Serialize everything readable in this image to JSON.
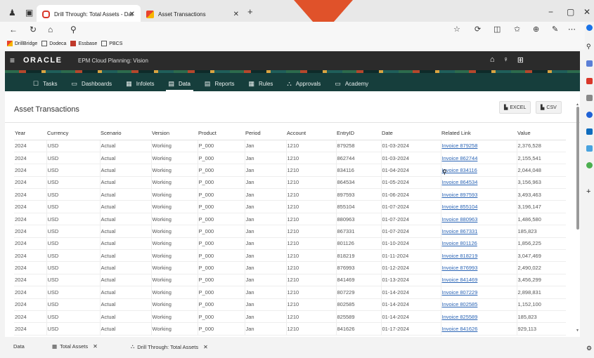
{
  "browser": {
    "tabs": [
      {
        "label": "Drill Through: Total Assets - Dat",
        "active": true
      },
      {
        "label": "Asset Transactions",
        "active": false
      }
    ],
    "new_tab": "+",
    "window": {
      "minimize": "−",
      "restore": "▢",
      "close": "✕"
    },
    "bookmarks": [
      "DrillBridge",
      "Dodeca",
      "Essbase",
      "PBCS"
    ]
  },
  "header": {
    "brand": "ORACLE",
    "app_title": "EPM Cloud Planning: Vision"
  },
  "nav": {
    "items": [
      {
        "label": "Tasks",
        "icon": "☐"
      },
      {
        "label": "Dashboards",
        "icon": "▭"
      },
      {
        "label": "Infolets",
        "icon": "▦"
      },
      {
        "label": "Data",
        "icon": "▤",
        "active": true
      },
      {
        "label": "Reports",
        "icon": "▤"
      },
      {
        "label": "Rules",
        "icon": "▦"
      },
      {
        "label": "Approvals",
        "icon": "⛬"
      },
      {
        "label": "Academy",
        "icon": "▭"
      }
    ]
  },
  "page": {
    "title": "Asset Transactions",
    "excel_label": "EXCEL",
    "csv_label": "CSV"
  },
  "table": {
    "columns": [
      "Year",
      "Currency",
      "Scenario",
      "Version",
      "Product",
      "Period",
      "Account",
      "EntryID",
      "Date",
      "Related Link",
      "Value"
    ],
    "rows": [
      [
        "2024",
        "USD",
        "Actual",
        "Working",
        "P_000",
        "Jan",
        "1210",
        "879258",
        "01-03-2024",
        "Invoice 879258",
        "2,376,528"
      ],
      [
        "2024",
        "USD",
        "Actual",
        "Working",
        "P_000",
        "Jan",
        "1210",
        "862744",
        "01-03-2024",
        "Invoice 862744",
        "2,155,541"
      ],
      [
        "2024",
        "USD",
        "Actual",
        "Working",
        "P_000",
        "Jan",
        "1210",
        "834116",
        "01-04-2024",
        "Invoice 834116",
        "2,044,048"
      ],
      [
        "2024",
        "USD",
        "Actual",
        "Working",
        "P_000",
        "Jan",
        "1210",
        "864534",
        "01-05-2024",
        "Invoice 864534",
        "3,156,963"
      ],
      [
        "2024",
        "USD",
        "Actual",
        "Working",
        "P_000",
        "Jan",
        "1210",
        "897593",
        "01-06-2024",
        "Invoice 897593",
        "3,493,463"
      ],
      [
        "2024",
        "USD",
        "Actual",
        "Working",
        "P_000",
        "Jan",
        "1210",
        "855104",
        "01-07-2024",
        "Invoice 855104",
        "3,196,147"
      ],
      [
        "2024",
        "USD",
        "Actual",
        "Working",
        "P_000",
        "Jan",
        "1210",
        "880963",
        "01-07-2024",
        "Invoice 880963",
        "1,486,580"
      ],
      [
        "2024",
        "USD",
        "Actual",
        "Working",
        "P_000",
        "Jan",
        "1210",
        "867331",
        "01-07-2024",
        "Invoice 867331",
        "185,823"
      ],
      [
        "2024",
        "USD",
        "Actual",
        "Working",
        "P_000",
        "Jan",
        "1210",
        "801126",
        "01-10-2024",
        "Invoice 801126",
        "1,856,225"
      ],
      [
        "2024",
        "USD",
        "Actual",
        "Working",
        "P_000",
        "Jan",
        "1210",
        "818219",
        "01-11-2024",
        "Invoice 818219",
        "3,047,469"
      ],
      [
        "2024",
        "USD",
        "Actual",
        "Working",
        "P_000",
        "Jan",
        "1210",
        "876993",
        "01-12-2024",
        "Invoice 876993",
        "2,490,022"
      ],
      [
        "2024",
        "USD",
        "Actual",
        "Working",
        "P_000",
        "Jan",
        "1210",
        "841469",
        "01-13-2024",
        "Invoice 841469",
        "3,456,299"
      ],
      [
        "2024",
        "USD",
        "Actual",
        "Working",
        "P_000",
        "Jan",
        "1210",
        "807229",
        "01-14-2024",
        "Invoice 807229",
        "2,898,831"
      ],
      [
        "2024",
        "USD",
        "Actual",
        "Working",
        "P_000",
        "Jan",
        "1210",
        "802585",
        "01-14-2024",
        "Invoice 802585",
        "1,152,100"
      ],
      [
        "2024",
        "USD",
        "Actual",
        "Working",
        "P_000",
        "Jan",
        "1210",
        "825589",
        "01-14-2024",
        "Invoice 825589",
        "185,823"
      ],
      [
        "2024",
        "USD",
        "Actual",
        "Working",
        "P_000",
        "Jan",
        "1210",
        "841626",
        "01-17-2024",
        "Invoice 841626",
        "929,113"
      ]
    ]
  },
  "bottom_tabs": [
    {
      "label": "Data",
      "closable": false
    },
    {
      "label": "Total Assets",
      "closable": true
    },
    {
      "label": "Drill Through: Total Assets",
      "closable": true
    }
  ]
}
